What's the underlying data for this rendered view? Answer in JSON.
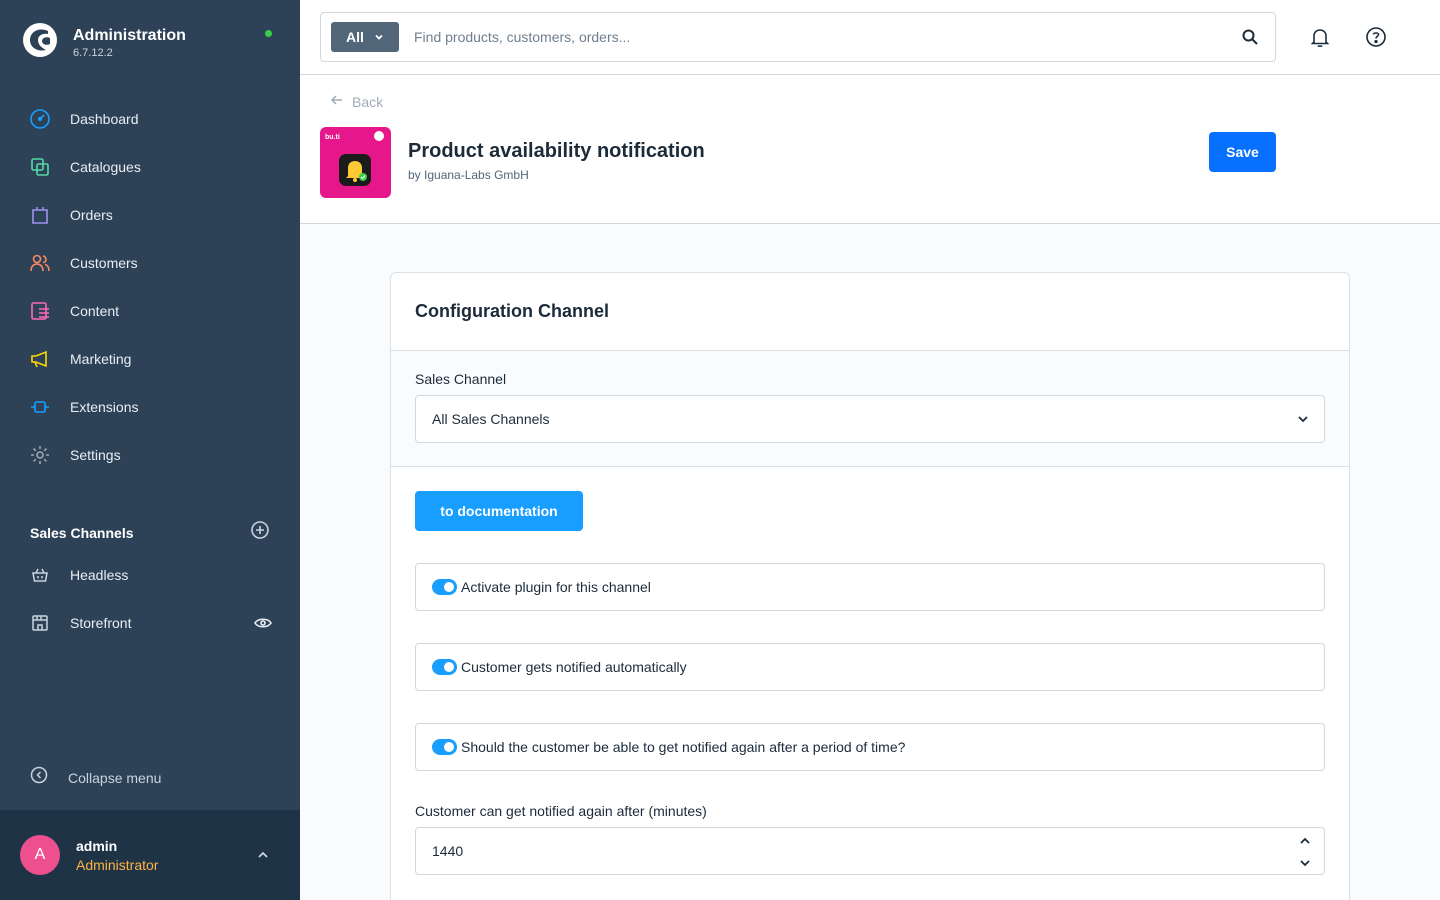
{
  "sidebar": {
    "brand_title": "Administration",
    "version": "6.7.12.2",
    "nav": [
      {
        "label": "Dashboard",
        "icon": "dashboard-icon",
        "color": "#189eff"
      },
      {
        "label": "Catalogues",
        "icon": "catalogue-icon",
        "color": "#57d9a3"
      },
      {
        "label": "Orders",
        "icon": "orders-icon",
        "color": "#a092f0"
      },
      {
        "label": "Customers",
        "icon": "customers-icon",
        "color": "#f88962"
      },
      {
        "label": "Content",
        "icon": "content-icon",
        "color": "#ff68b4"
      },
      {
        "label": "Marketing",
        "icon": "marketing-icon",
        "color": "#ffd700"
      },
      {
        "label": "Extensions",
        "icon": "extensions-icon",
        "color": "#189eff"
      },
      {
        "label": "Settings",
        "icon": "settings-icon",
        "color": "#9aa8b5"
      }
    ],
    "sales_channels_title": "Sales Channels",
    "sales_channels": [
      {
        "label": "Headless",
        "icon": "basket-icon"
      },
      {
        "label": "Storefront",
        "icon": "storefront-icon"
      }
    ],
    "collapse_label": "Collapse menu",
    "user": {
      "initial": "A",
      "name": "admin",
      "role": "Administrator"
    }
  },
  "topbar": {
    "search_type": "All",
    "search_placeholder": "Find products, customers, orders..."
  },
  "header": {
    "back_label": "Back",
    "plugin_title": "Product availability notification",
    "plugin_vendor": "by Iguana-Labs GmbH",
    "save_label": "Save",
    "icon_badge_text": "bu.ti"
  },
  "card": {
    "title": "Configuration Channel",
    "sales_channel_label": "Sales Channel",
    "sales_channel_value": "All Sales Channels",
    "doc_button": "to documentation",
    "toggles": [
      {
        "label": "Activate plugin for this channel",
        "on": true
      },
      {
        "label": "Customer gets notified automatically",
        "on": true
      },
      {
        "label": "Should the customer be able to get notified again after a period of time?",
        "on": true
      }
    ],
    "renotify_label": "Customer can get notified again after (minutes)",
    "renotify_value": "1440"
  }
}
